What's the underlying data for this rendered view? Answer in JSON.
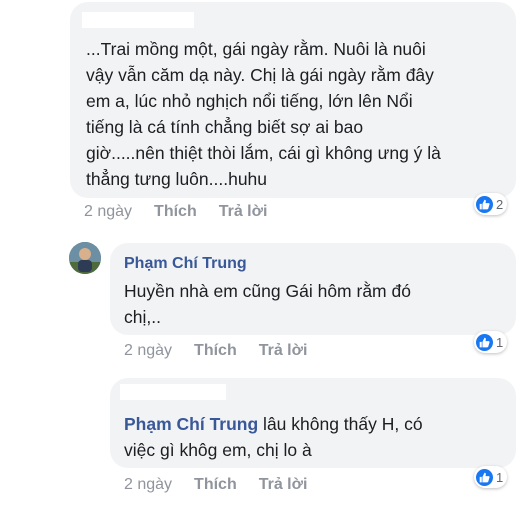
{
  "comment1": {
    "lines": [
      "...Trai mồng một, gái ngày rằm. Nuôi là nuôi",
      "vậy vẫn căm dạ này. Chị là gái ngày rằm đây",
      "em a, lúc nhỏ nghịch nổi tiếng, lớn lên Nổi",
      "tiếng là cá tính chẳng biết sợ ai bao",
      "giờ.....nên thiệt thòi lắm, cái gì không ưng ý là",
      "thẳng tưng luôn....huhu"
    ],
    "time": "2 ngày",
    "like": "Thích",
    "reply": "Trả lời",
    "reactions": "2"
  },
  "comment2": {
    "author": "Phạm Chí Trung",
    "lines": [
      "Huyền nhà em cũng Gái hôm rằm đó",
      "chị,.."
    ],
    "time": "2 ngày",
    "like": "Thích",
    "reply": "Trả lời",
    "reactions": "1"
  },
  "comment3": {
    "author": "Phạm Chí Trung",
    "line1_rest": " lâu không thấy H, có",
    "line2": "việc gì khôg em, chị lo à",
    "time": "2 ngày",
    "like": "Thích",
    "reply": "Trả lời",
    "reactions": "1"
  },
  "icons": {
    "like": "like-icon",
    "avatar": "avatar"
  },
  "colors": {
    "bubble": "#f2f3f5",
    "link": "#385898",
    "meta": "#90949c",
    "like": "#1877f2"
  }
}
